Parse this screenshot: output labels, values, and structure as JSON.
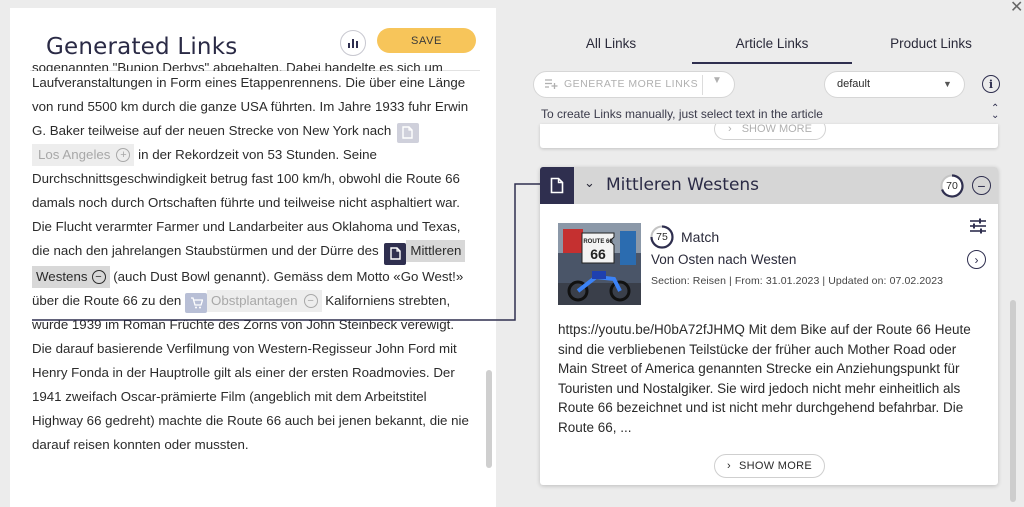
{
  "left": {
    "title": "Generated Links",
    "stats_icon": "bar-chart-icon",
    "save_label": "SAVE",
    "article": {
      "cut_line": "sogenannten \"Bunion Derbys\" abgehalten. Dabei handelte es sich um",
      "p1_a": "Laufveranstaltungen in Form eines Etappenrennens. Die über eine Länge von rund 5500 km durch die ganze USA führten. Im Jahre 1933 fuhr Erwin G. Baker teilweise auf der neuen Strecke von New York nach",
      "link_los_angeles": "Los Angeles",
      "p1_b": "in der Rekordzeit von 53 Stunden. Seine Durchschnittsgeschwindigkeit betrug fast 100 km/h, obwohl die Route 66 damals noch durch Ortschaften führte und teilweise nicht asphaltiert war.",
      "p2_a": "Die Flucht verarmter Farmer und Landarbeiter aus Oklahoma und Texas, die nach den jahrelangen Staubstürmen und der Dürre des",
      "link_mittleren_westens_1": "Mittleren",
      "link_mittleren_westens_2": "Westens",
      "p2_b": "(auch Dust Bowl genannt). Gemäss dem Motto «Go West!» über die Route 66 zu den",
      "link_obstplantagen": "Obstplantagen",
      "p2_c": "Kaliforniens strebten, wurde 1939 im Roman Früchte des Zorns von John Steinbeck verewigt. Die darauf basierende Verfilmung von Western-Regisseur John Ford mit Henry Fonda in der Hauptrolle gilt als einer der ersten Roadmovies. Der 1941 zweifach Oscar-prämierte Film (angeblich mit dem Arbeitstitel Highway 66 gedreht) machte die Route 66 auch bei jenen bekannt, die nie darauf reisen konnten oder mussten."
    }
  },
  "right": {
    "tabs": [
      {
        "label": "All Links",
        "active": false
      },
      {
        "label": "Article Links",
        "active": true
      },
      {
        "label": "Product Links",
        "active": false
      }
    ],
    "generate_label": "GENERATE MORE LINKS",
    "select_value": "default",
    "hint": "To create Links manually, just select text in the article",
    "prev_show_more": "SHOW MORE",
    "card": {
      "title": "Mittleren Westens",
      "score": "70",
      "match_score": "75",
      "match_label": "Match",
      "video_title": "Von Osten nach Westen",
      "meta": "Section: Reisen | From: 31.01.2023 | Updated on: 07.02.2023",
      "description": "https://youtu.be/H0bA72fJHMQ Mit dem Bike auf der Route 66 Heute sind die verbliebenen Teilstücke der früher auch Mother Road oder Main Street of America genannten Strecke ein Anziehungspunkt für Touristen und Nostalgiker. Sie wird jedoch nicht mehr einheitlich als Route 66 bezeichnet und ist nicht mehr durchgehend befahrbar. Die Route 66, ...",
      "show_more": "SHOW MORE",
      "thumbnail_sign": "ROUTE 66"
    }
  },
  "colors": {
    "accent": "#2f2f4f",
    "save": "#f7c55a",
    "header_gray": "#d6d6d6"
  }
}
